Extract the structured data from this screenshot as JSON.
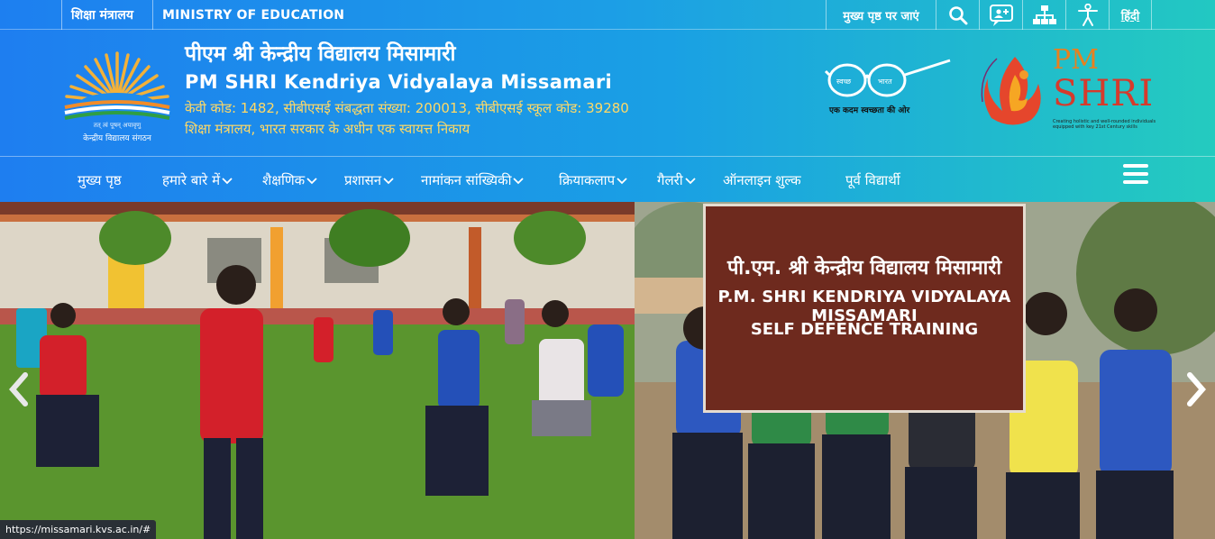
{
  "topbar": {
    "ministry_hindi": "शिक्षा मंत्रालय",
    "ministry_english": "MINISTRY OF EDUCATION",
    "skip_to_main": "मुख्य पृष्ठ पर जाएं",
    "language": "हिंदी",
    "icons": [
      "search-icon",
      "screen-reader-icon",
      "sitemap-icon",
      "accessibility-icon"
    ]
  },
  "header": {
    "school_name_hindi": "पीएम श्री केन्द्रीय विद्यालय मिसामारी",
    "school_name_english": "PM SHRI Kendriya Vidyalaya Missamari",
    "codes": "केवी कोड: 1482, सीबीएसई संबद्धता संख्या: 200013, सीबीएसई स्कूल कोड: 39280",
    "authority": "शिक्षा मंत्रालय, भारत सरकार के अधीन एक स्वायत्त निकाय",
    "kvs_logo_motto": "तत् त्वं पूषन् अपावृणु",
    "kvs_logo_label": "केन्द्रीय विद्यालय संगठन",
    "swachh_tagline": "एक कदम स्वच्छता की ओर",
    "swachh_left": "स्वच्छ",
    "swachh_right": "भारत",
    "pmshri_pm": "PM",
    "pmshri_shri": "SHRI",
    "pmshri_sub": "Creating holistic and well-rounded individuals equipped with key 21st Century skills",
    "pmshri_arc": "Pradhan Mantri Schools for Rising India"
  },
  "nav": {
    "items": [
      {
        "label": "मुख्य पृष्ठ",
        "dropdown": false
      },
      {
        "label": "हमारे बारे में",
        "dropdown": true
      },
      {
        "label": "शैक्षणिक",
        "dropdown": true
      },
      {
        "label": "प्रशासन",
        "dropdown": true
      },
      {
        "label": "नामांकन सांख्यिकी",
        "dropdown": true
      },
      {
        "label": "क्रियाकलाप",
        "dropdown": true
      },
      {
        "label": "गैलरी",
        "dropdown": true
      },
      {
        "label": "ऑनलाइन शुल्क",
        "dropdown": false
      },
      {
        "label": "पूर्व विद्यार्थी",
        "dropdown": false
      }
    ]
  },
  "hero": {
    "banner_line1": "पी.एम. श्री केन्द्रीय विद्यालय मिसामारी",
    "banner_line2": "P.M. SHRI KENDRIYA VIDYALAYA MISSAMARI",
    "banner_line3": "SELF DEFENCE TRAINING",
    "banner_logo_label": "PM SHRI"
  },
  "status_url": "https://missamari.kvs.ac.in/#"
}
